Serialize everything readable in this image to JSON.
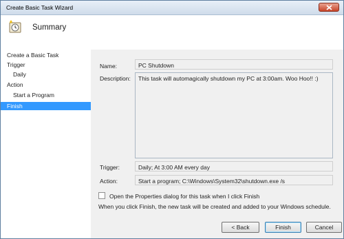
{
  "window": {
    "title": "Create Basic Task Wizard"
  },
  "header": {
    "title": "Summary"
  },
  "sidebar": {
    "items": [
      {
        "label": "Create a Basic Task"
      },
      {
        "label": "Trigger"
      },
      {
        "label": "Daily"
      },
      {
        "label": "Action"
      },
      {
        "label": "Start a Program"
      },
      {
        "label": "Finish",
        "active": true
      }
    ]
  },
  "summary": {
    "name_label": "Name:",
    "name_value": "PC Shutdown",
    "description_label": "Description:",
    "description_value": "This task will automagically shutdown my PC at 3:00am.  Woo Hoo!!  :)",
    "trigger_label": "Trigger:",
    "trigger_value": "Daily; At 3:00 AM every day",
    "action_label": "Action:",
    "action_value": "Start a program; C:\\Windows\\System32\\shutdown.exe /s"
  },
  "options": {
    "open_properties_label": "Open the Properties dialog for this task when I click Finish",
    "open_properties_checked": false,
    "info_text": "When you click Finish, the new task will be created and added to your Windows schedule."
  },
  "buttons": {
    "back": "< Back",
    "finish": "Finish",
    "cancel": "Cancel"
  },
  "colors": {
    "selection": "#3399ff",
    "close_button": "#c7452a"
  }
}
